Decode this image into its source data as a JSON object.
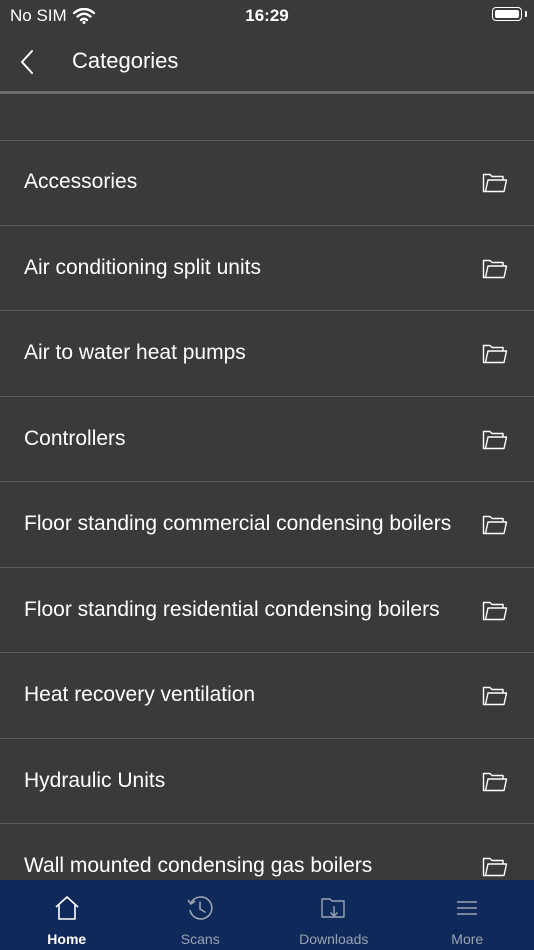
{
  "status": {
    "carrier": "No SIM",
    "time": "16:29"
  },
  "nav": {
    "title": "Categories"
  },
  "categories": [
    "Accessories",
    "Air conditioning split units",
    "Air to water heat pumps",
    "Controllers",
    "Floor standing commercial condensing boilers",
    "Floor standing residential condensing boilers",
    "Heat recovery ventilation",
    "Hydraulic Units",
    "Wall mounted condensing gas boilers"
  ],
  "tabs": [
    {
      "label": "Home",
      "icon": "home-icon",
      "active": true
    },
    {
      "label": "Scans",
      "icon": "history-icon",
      "active": false
    },
    {
      "label": "Downloads",
      "icon": "downloads-folder-icon",
      "active": false
    },
    {
      "label": "More",
      "icon": "menu-icon",
      "active": false
    }
  ],
  "colors": {
    "background": "#3a3a38",
    "tab_bar": "#0f2a5a",
    "divider": "#5a5a58"
  }
}
